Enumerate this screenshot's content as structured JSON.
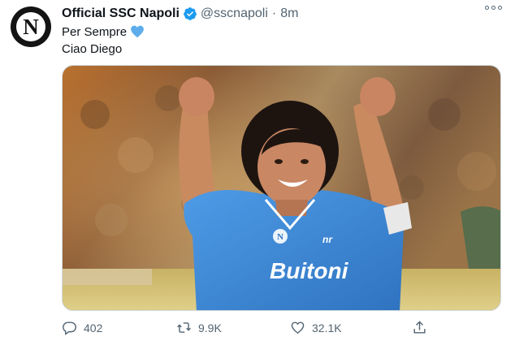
{
  "tweet": {
    "display_name": "Official SSC Napoli",
    "handle": "@sscnapoli",
    "separator": "·",
    "time": "8m",
    "line1": "Per Sempre",
    "line2": "Ciao Diego",
    "avatar_letter": "N",
    "jersey_text": "Buitoni"
  },
  "actions": {
    "replies": "402",
    "retweets": "9.9K",
    "likes": "32.1K"
  },
  "icons": {
    "verified": "verified-badge-icon",
    "heart_emoji": "blue-heart-icon",
    "more": "more-options-icon",
    "reply": "reply-icon",
    "retweet": "retweet-icon",
    "like": "like-icon",
    "share": "share-icon"
  },
  "colors": {
    "verified": "#1d9bf0",
    "emoji_heart": "#5dadec",
    "text_secondary": "#536471",
    "jersey": "#3f8fdc"
  }
}
